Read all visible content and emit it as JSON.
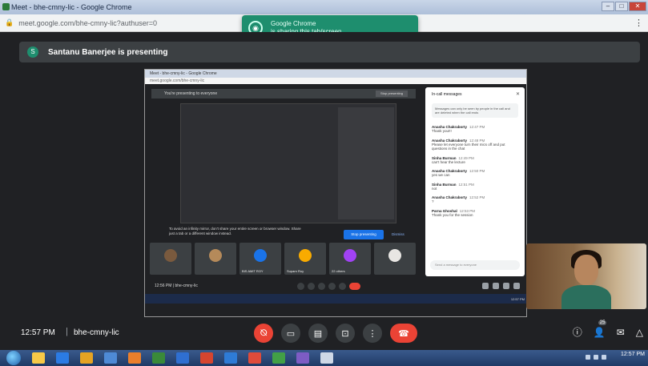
{
  "window": {
    "title": "Meet - bhe-cmny-lic - Google Chrome",
    "buttons": {
      "minimize": "–",
      "maximize": "□",
      "close": "✕"
    }
  },
  "address": {
    "url": "meet.google.com/bhe-cmny-lic?authuser=0"
  },
  "toast": {
    "app": "Google Chrome",
    "message": "is sharing this tab/screen"
  },
  "presenting": {
    "initial": "S",
    "text": "Santanu Banerjee is presenting"
  },
  "shared_screen": {
    "title": "Meet - bhe-cmny-lic - Google Chrome",
    "url": "meet.google.com/bhe-cmny-lic",
    "presenting_text": "You're presenting to everyone",
    "stop_label": "Stop presenting",
    "warning": "To avoid an infinity mirror, don't share your entire screen or browser window. Share just a tab or a different window instead.",
    "stop_button": "Stop presenting",
    "dismiss": "Dismiss",
    "chat": {
      "title": "In-call messages",
      "info": "Messages can only be seen by people in the call and are deleted when the call ends",
      "messages": [
        {
          "sender": "Anasha Chakraborty",
          "time": "12:47 PM",
          "text": "Thank you!!!"
        },
        {
          "sender": "Anasha Chakraborty",
          "time": "12:48 PM",
          "text": "Please let everyone turn their mics off and put questions in the chat"
        },
        {
          "sender": "Sinha Burman",
          "time": "12:49 PM",
          "text": "can't hear the lecture"
        },
        {
          "sender": "Anasha Chakraborty",
          "time": "12:50 PM",
          "text": "yes we can"
        },
        {
          "sender": "Sinha Burman",
          "time": "12:51 PM",
          "text": "not"
        },
        {
          "sender": "Anasha Chakraborty",
          "time": "12:52 PM",
          "text": "?"
        },
        {
          "sender": "Parna Ghoshal",
          "time": "12:53 PM",
          "text": "Thank you for the session"
        }
      ],
      "input_placeholder": "Send a message to everyone"
    },
    "tiles": [
      {
        "name": "",
        "color": "#7a5a3e"
      },
      {
        "name": "",
        "color": "#b58a5a"
      },
      {
        "name": "BIS AMIT ROY",
        "color": "#1a73e8"
      },
      {
        "name": "Suparn Roy",
        "color": "#f9ab00"
      },
      {
        "name": "22 others",
        "color": "#a142f4"
      },
      {
        "name": "",
        "color": "#e8e6e3"
      }
    ],
    "ctrl_info": "12:56 PM | bhe-cmny-lic",
    "taskbar_time": "12:57 PM"
  },
  "meeting": {
    "time": "12:57 PM",
    "separator": "|",
    "code": "bhe-cmny-lic"
  },
  "controls": {
    "mic": "⦰",
    "camera": "▭",
    "captions": "▤",
    "present": "⊡",
    "more": "⋮",
    "hangup": "☎"
  },
  "right_controls": {
    "info": "ⓘ",
    "people": "👤",
    "people_count": "25",
    "chat": "✉",
    "activities": "△"
  },
  "taskbar": {
    "time": "12:57 PM",
    "date": "",
    "app_colors": [
      "#f7c948",
      "#2b7be4",
      "#e5a323",
      "#4e8ad6",
      "#eb7f2b",
      "#3a8a3a",
      "#2f6fd1",
      "#d6452f",
      "#2e7bd6",
      "#e04b3a",
      "#42a046",
      "#7d5cc4",
      "#cfd8e6"
    ]
  }
}
